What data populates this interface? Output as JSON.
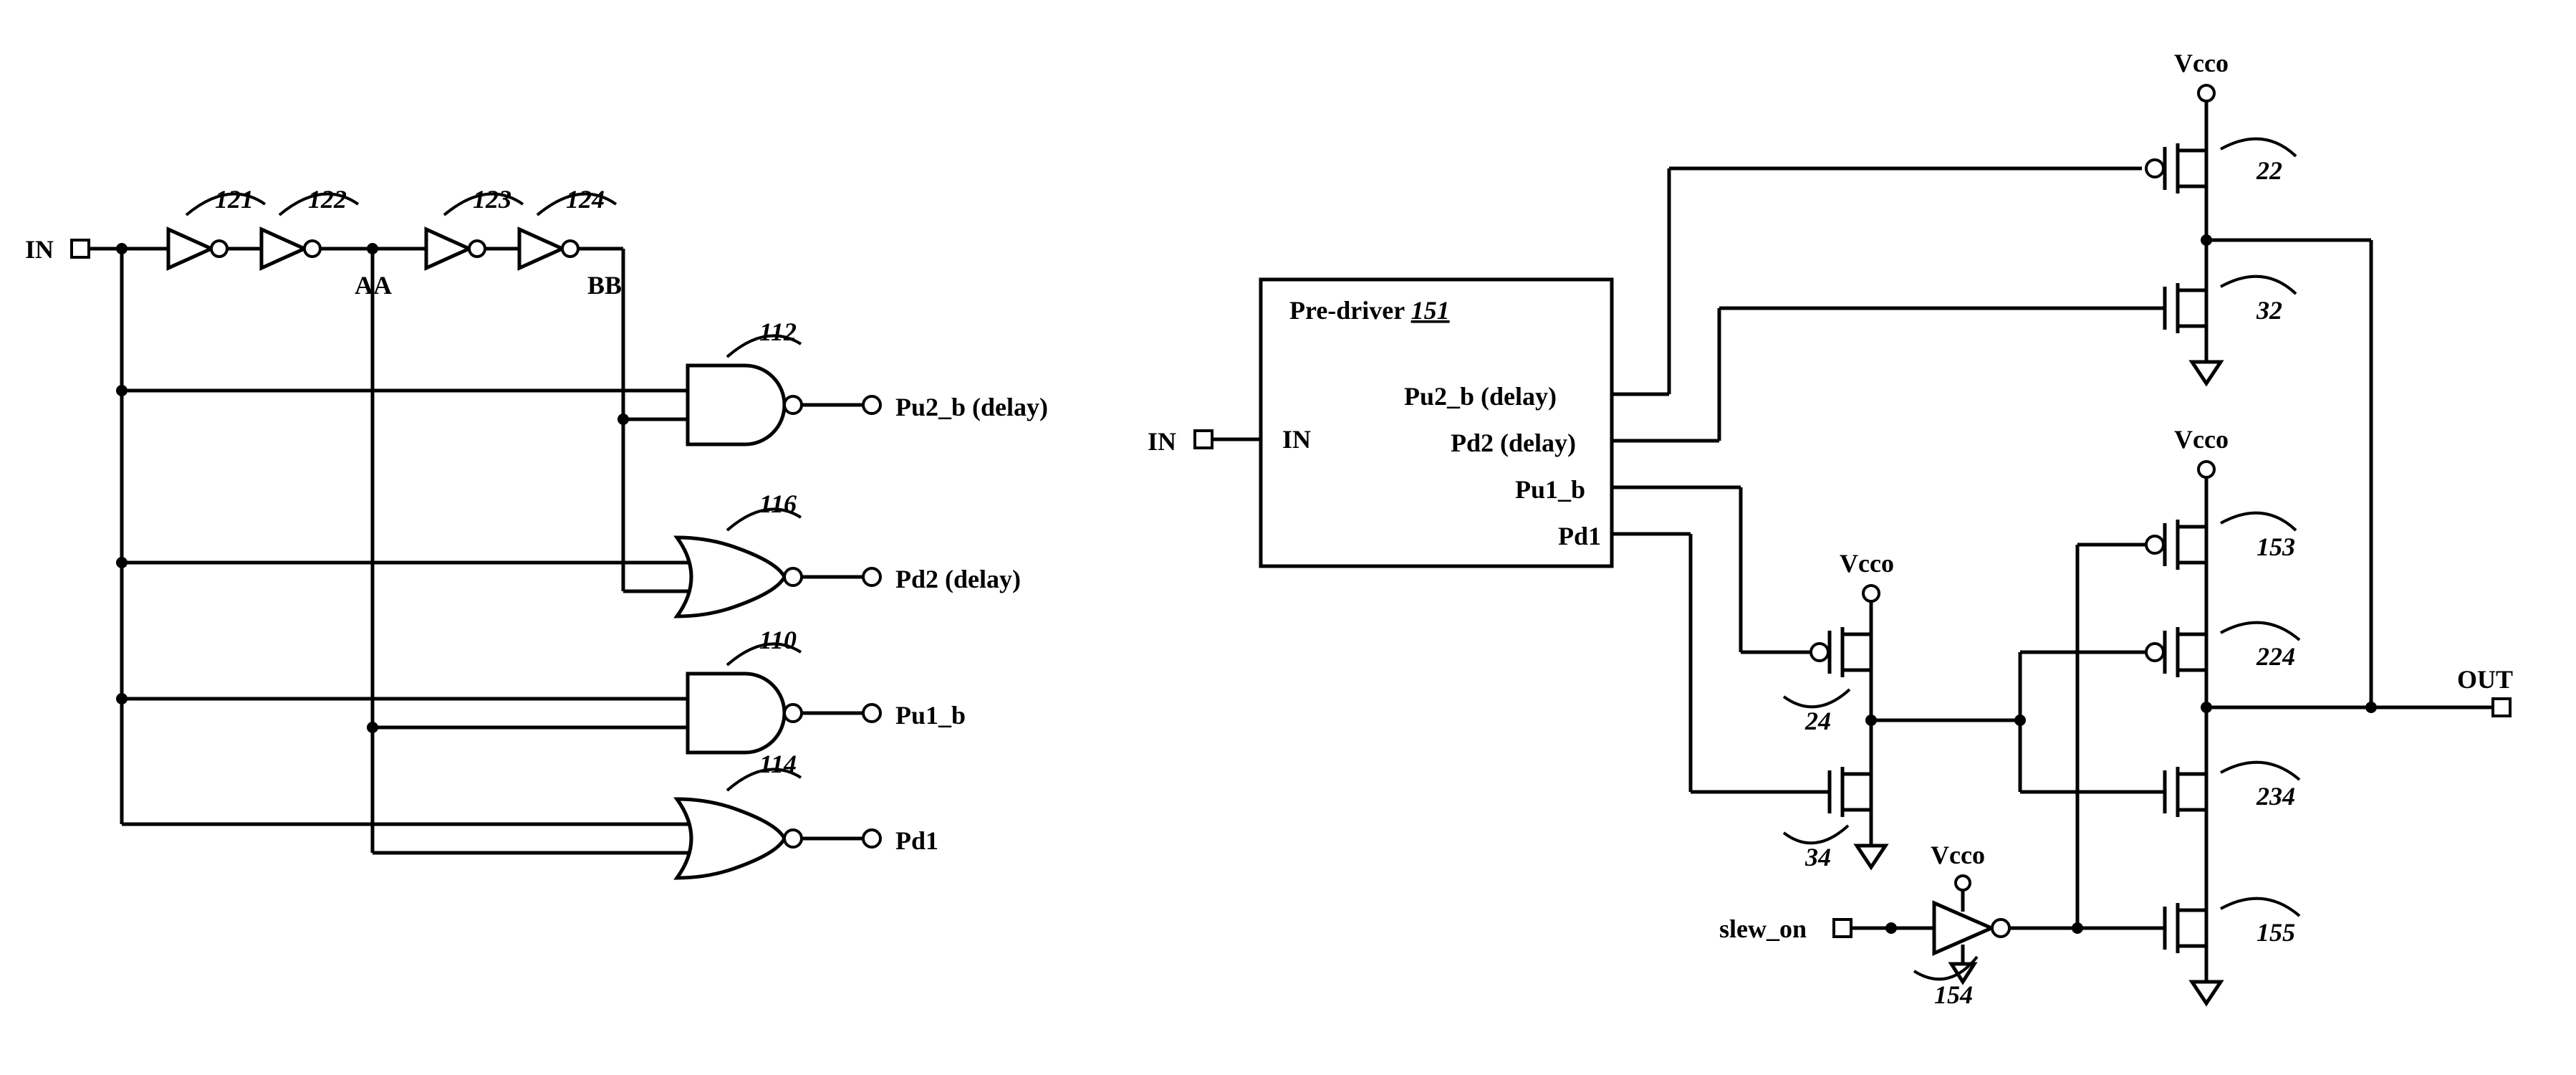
{
  "left": {
    "in": "IN",
    "aa": "AA",
    "bb": "BB",
    "inv": {
      "r121": "121",
      "r122": "122",
      "r123": "123",
      "r124": "124"
    },
    "gates": {
      "nand_top": {
        "ref": "112",
        "out": "Pu2_b (delay)"
      },
      "nor_top": {
        "ref": "116",
        "out": "Pd2 (delay)"
      },
      "nand_bot": {
        "ref": "110",
        "out": "Pu1_b"
      },
      "nor_bot": {
        "ref": "114",
        "out": "Pd1"
      }
    }
  },
  "right": {
    "predriver": {
      "title": "Pre-driver",
      "ref": "151",
      "in": "IN",
      "ports": {
        "pu2b": "Pu2_b (delay)",
        "pd2": "Pd2 (delay)",
        "pu1b": "Pu1_b",
        "pd1": "Pd1"
      }
    },
    "supply": "Vcco",
    "out": "OUT",
    "slew": "slew_on",
    "refs": {
      "t22": "22",
      "t32": "32",
      "t153": "153",
      "t224": "224",
      "t234": "234",
      "t155": "155",
      "t24": "24",
      "t34": "34",
      "inv154": "154"
    }
  }
}
